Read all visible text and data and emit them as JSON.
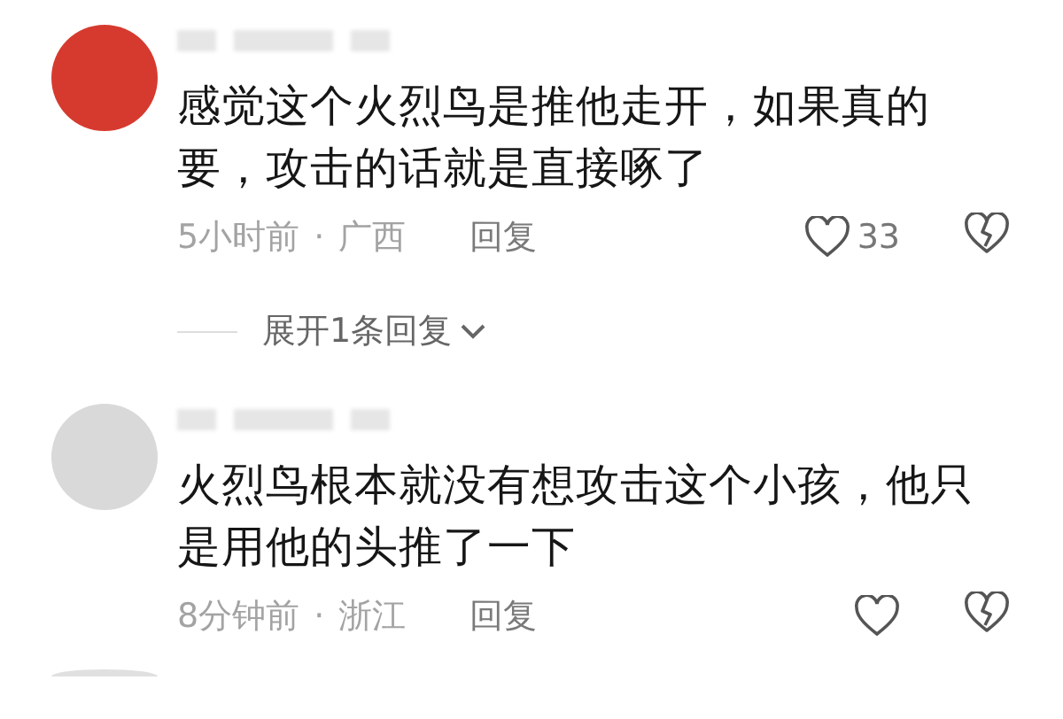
{
  "comments": [
    {
      "color": "#d63a2f",
      "text_lines": [
        "感觉这个火烈鸟是推他走开，如果真的",
        "要，攻击的话就是直接啄了"
      ],
      "time": "5小时前",
      "separator": "·",
      "location": "广西",
      "reply": "回复",
      "likes": "33",
      "expand_replies": "展开1条回复"
    },
    {
      "color": "#d9d9d9",
      "text_lines": [
        "火烈鸟根本就没有想攻击这个小孩，他只",
        "是用他的头推了一下"
      ],
      "time": "8分钟前",
      "separator": "·",
      "location": "浙江",
      "reply": "回复"
    }
  ]
}
